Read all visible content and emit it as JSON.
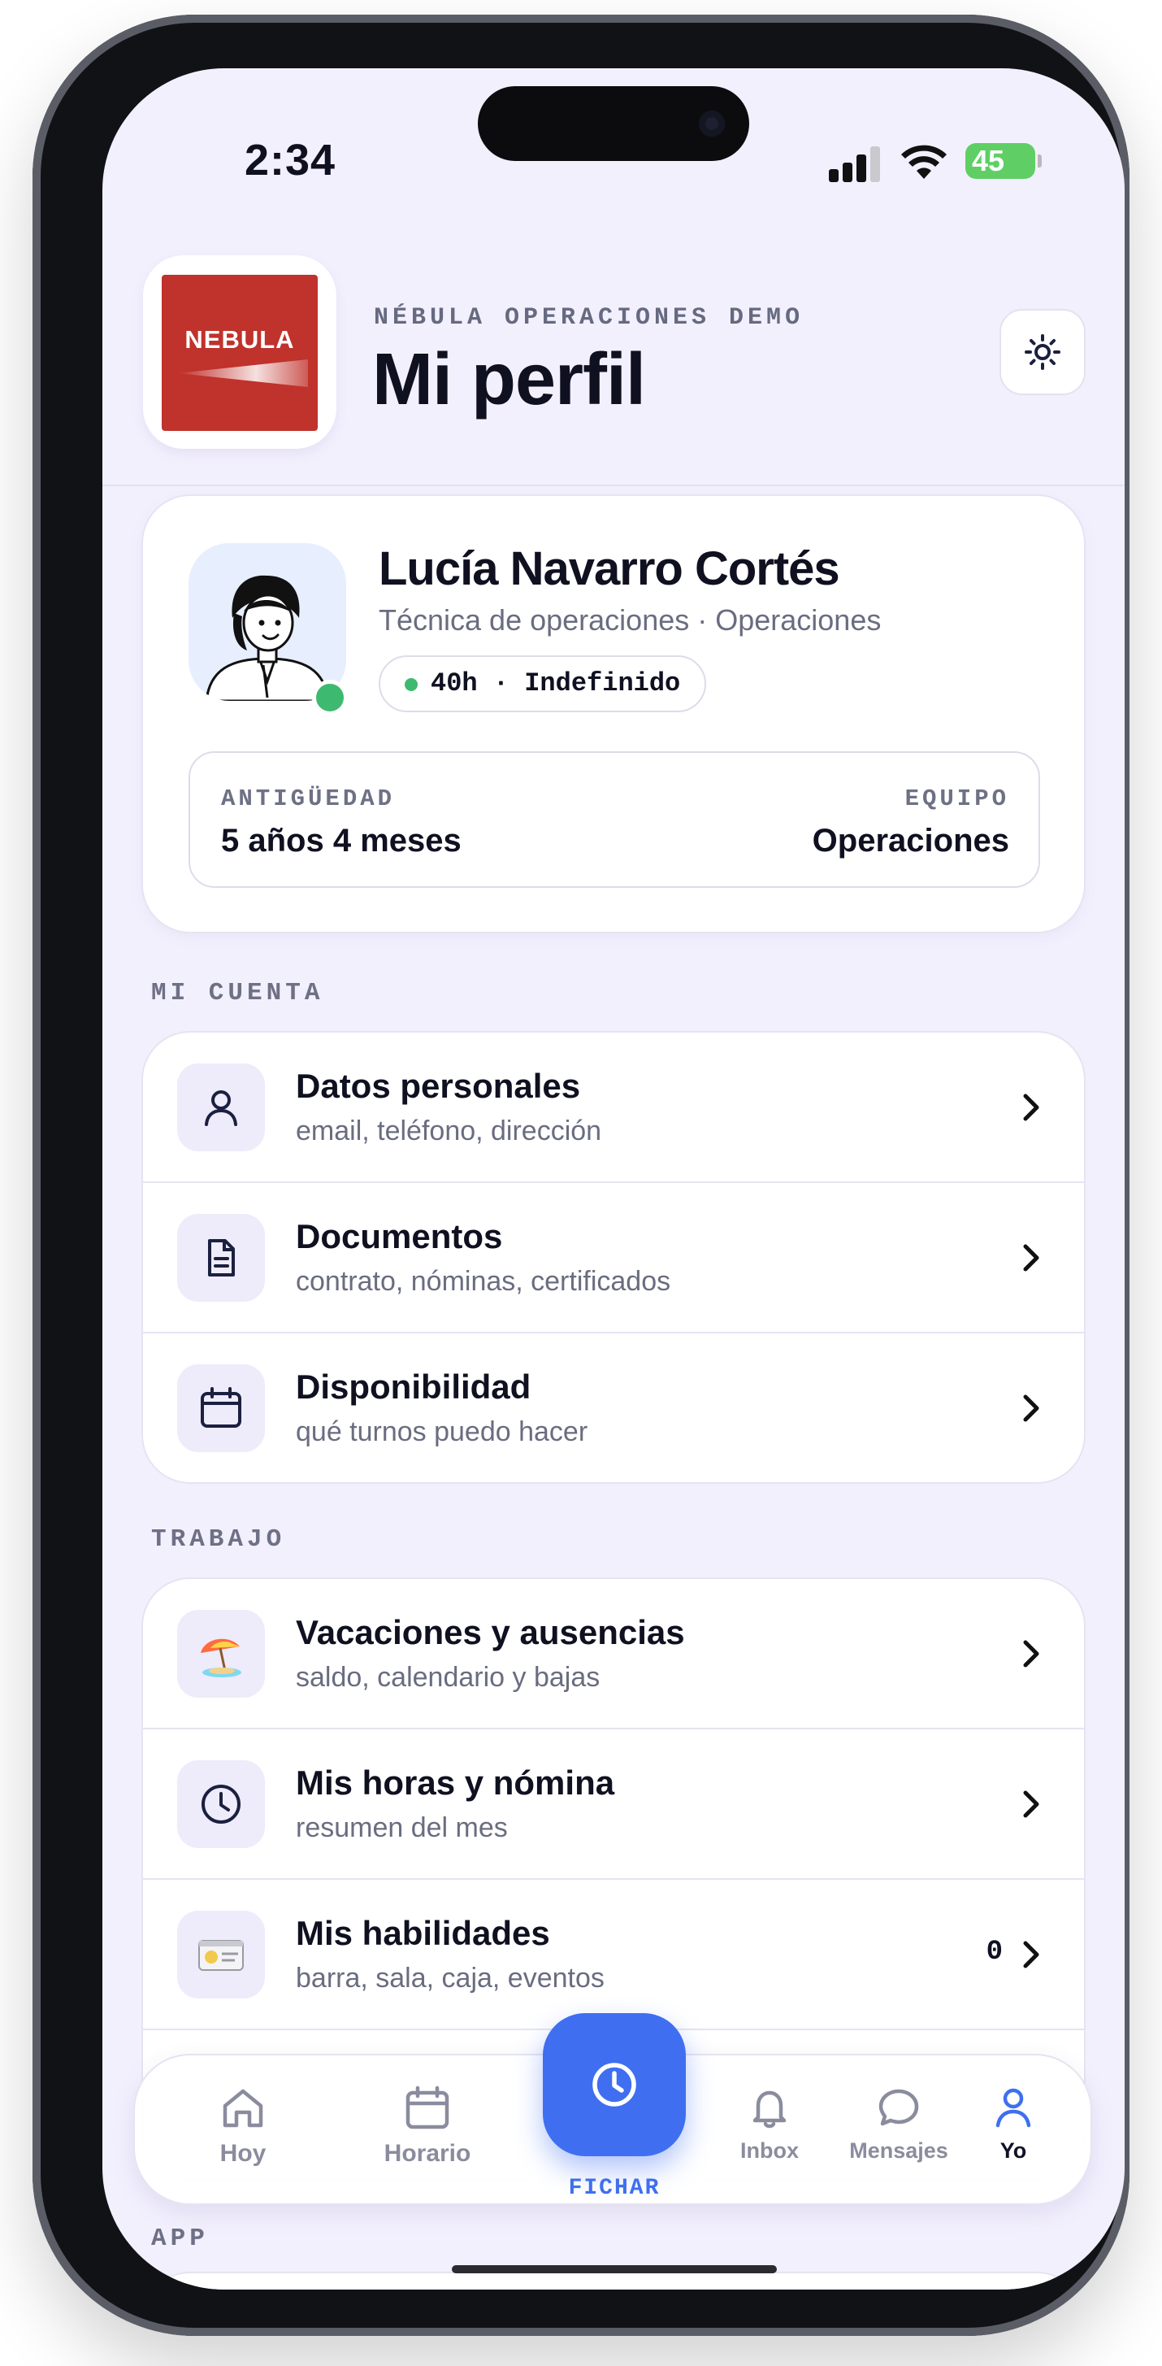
{
  "status": {
    "time": "2:34",
    "battery": "45"
  },
  "header": {
    "org": "NÉBULA OPERACIONES DEMO",
    "title": "Mi perfil",
    "logo_word": "NEBULA"
  },
  "profile": {
    "name": "Lucía Navarro Cortés",
    "role": "Técnica de operaciones · Operaciones",
    "contract": "40h · Indefinido",
    "seniority_label": "ANTIGÜEDAD",
    "seniority_value": "5 años 4 meses",
    "team_label": "EQUIPO",
    "team_value": "Operaciones"
  },
  "sections": {
    "account": {
      "label": "MI CUENTA",
      "items": [
        {
          "title": "Datos personales",
          "subtitle": "email, teléfono, dirección",
          "icon": "user-icon"
        },
        {
          "title": "Documentos",
          "subtitle": "contrato, nóminas, certificados",
          "icon": "document-icon"
        },
        {
          "title": "Disponibilidad",
          "subtitle": "qué turnos puedo hacer",
          "icon": "calendar-icon"
        }
      ]
    },
    "work": {
      "label": "TRABAJO",
      "items": [
        {
          "title": "Vacaciones y ausencias",
          "subtitle": "saldo, calendario y bajas",
          "icon": "beach-umbrella-icon"
        },
        {
          "title": "Mis horas y nómina",
          "subtitle": "resumen del mes",
          "icon": "clock-icon"
        },
        {
          "title": "Mis habilidades",
          "subtitle": "barra, sala, caja, eventos",
          "icon": "id-card-icon",
          "count": "0"
        }
      ]
    },
    "app": {
      "label": "APP"
    }
  },
  "tabbar": {
    "home": "Hoy",
    "schedule": "Horario",
    "clock_in": "FICHAR",
    "inbox": "Inbox",
    "messages": "Mensajes",
    "me": "Yo"
  },
  "colors": {
    "accent": "#3f6ff0",
    "online": "#3dba6f",
    "brand": "#c0322c",
    "background": "#f3f0fe"
  }
}
